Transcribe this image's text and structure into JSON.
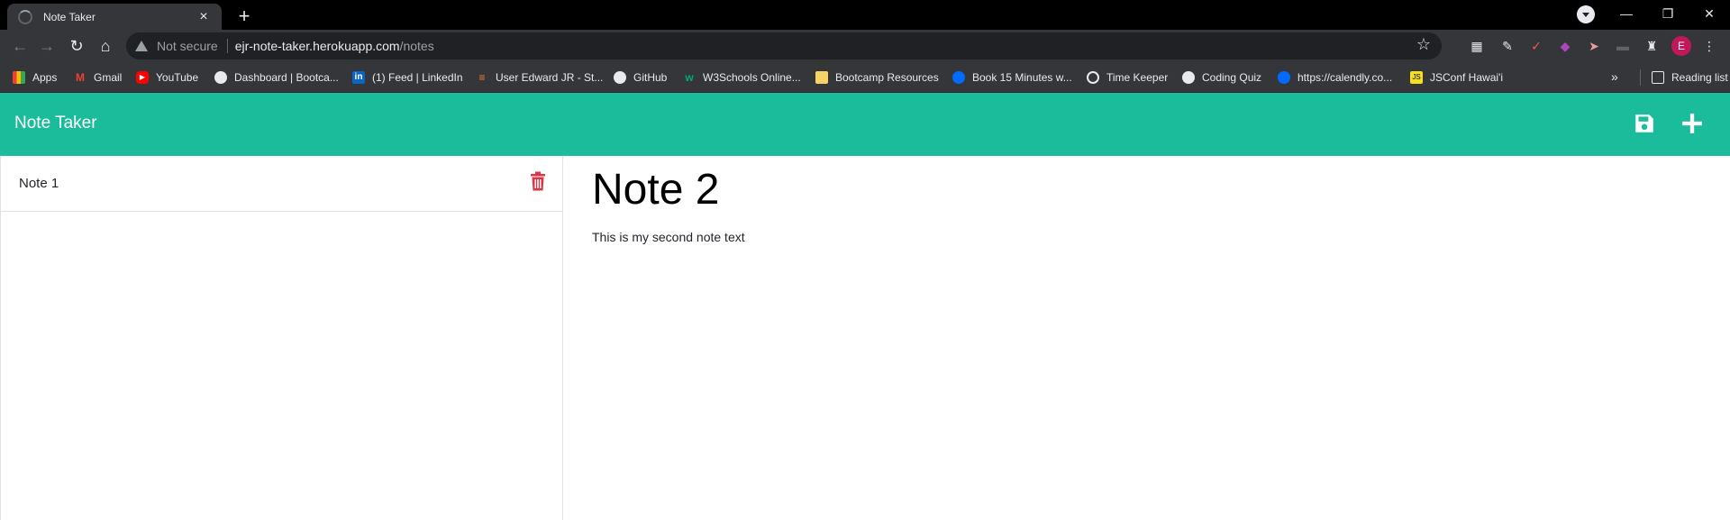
{
  "browser": {
    "tab_title": "Note Taker",
    "new_tab": "+",
    "security_label": "Not secure",
    "url_host": "ejr-note-taker.herokuapp.com",
    "url_path": "/notes",
    "avatar_letter": "E",
    "bookmarks": [
      {
        "label": "Apps",
        "icon": "apps-grid-icon",
        "color": "#f4b400"
      },
      {
        "label": "Gmail",
        "icon": "gmail-icon",
        "color": "#ea4335"
      },
      {
        "label": "YouTube",
        "icon": "youtube-icon",
        "color": "#ff0000"
      },
      {
        "label": "Dashboard | Bootca...",
        "icon": "globe-icon",
        "color": "#9aa0a6"
      },
      {
        "label": "(1) Feed | LinkedIn",
        "icon": "linkedin-icon",
        "color": "#0a66c2"
      },
      {
        "label": "User Edward JR - St...",
        "icon": "stackoverflow-icon",
        "color": "#f48024"
      },
      {
        "label": "GitHub",
        "icon": "github-icon",
        "color": "#e8eaed"
      },
      {
        "label": "W3Schools Online...",
        "icon": "w3schools-icon",
        "color": "#04aa6d"
      },
      {
        "label": "Bootcamp Resources",
        "icon": "folder-icon",
        "color": "#f6d365"
      },
      {
        "label": "Book 15 Minutes w...",
        "icon": "calendly-icon",
        "color": "#006bff"
      },
      {
        "label": "Time Keeper",
        "icon": "stopwatch-icon",
        "color": "#e8eaed"
      },
      {
        "label": "Coding Quiz",
        "icon": "globe-icon",
        "color": "#9aa0a6"
      },
      {
        "label": "https://calendly.co...",
        "icon": "calendly-icon",
        "color": "#006bff"
      },
      {
        "label": "JSConf Hawai'i",
        "icon": "js-icon",
        "color": "#f7df1e"
      }
    ],
    "more_bookmarks": "»",
    "reading_list": "Reading list"
  },
  "app": {
    "brand": "Note Taker",
    "theme_color": "#1abc9c",
    "delete_color": "#dc3545",
    "notes": [
      {
        "title": "Note 1"
      }
    ],
    "active_note": {
      "title": "Note 2",
      "text": "This is my second note text"
    }
  }
}
